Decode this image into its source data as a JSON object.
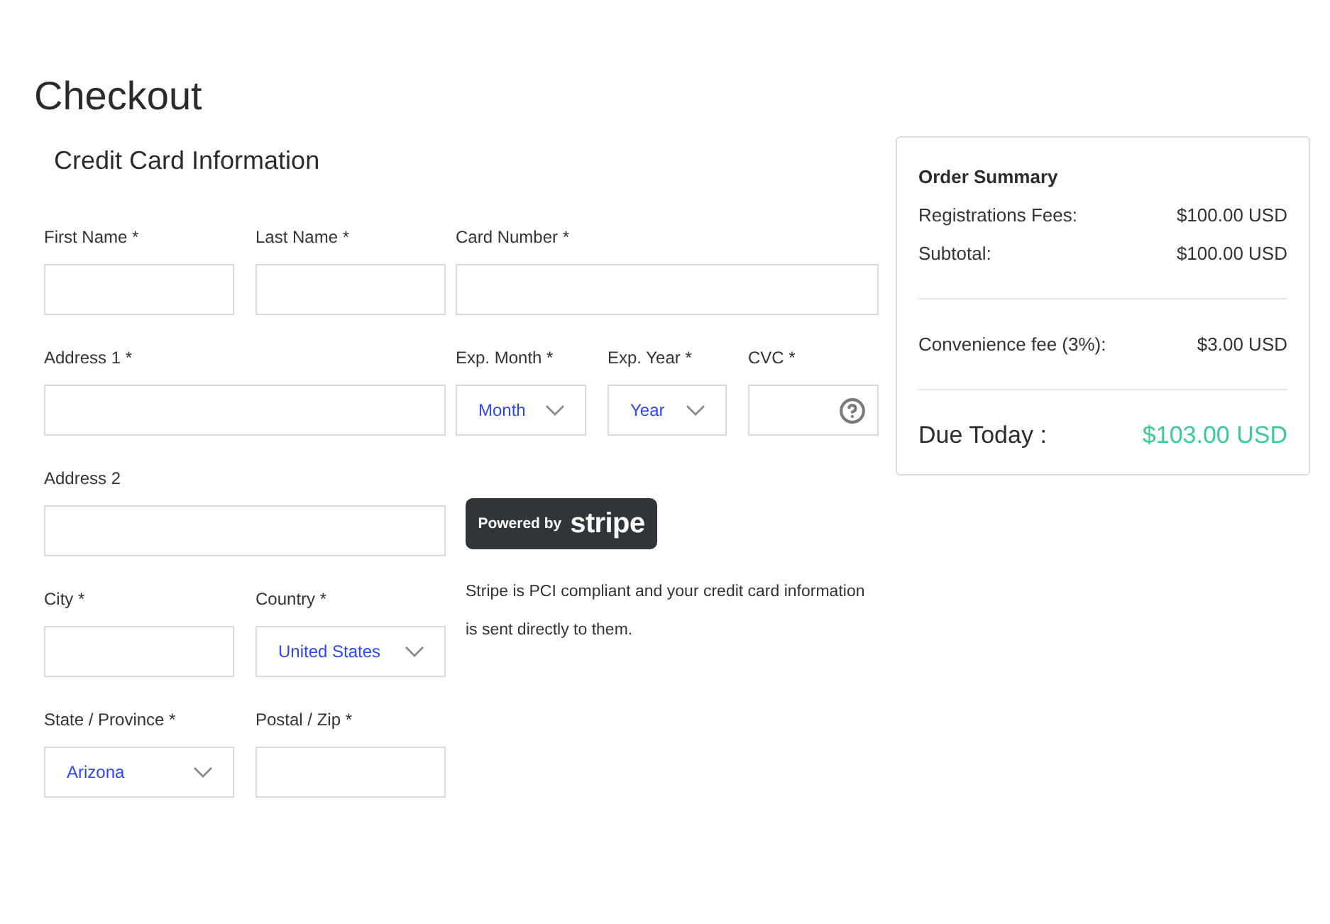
{
  "page": {
    "title": "Checkout"
  },
  "credit_card": {
    "heading": "Credit Card Information",
    "left_rows": [
      [
        {
          "label": "First Name *",
          "kind": "text"
        },
        {
          "label": "Last Name *",
          "kind": "text"
        }
      ],
      [
        {
          "label": "Address 1 *",
          "kind": "text"
        }
      ],
      [
        {
          "label": "Address 2",
          "kind": "text"
        }
      ],
      [
        {
          "label": "City *",
          "kind": "text"
        },
        {
          "label": "Country *",
          "kind": "select",
          "value": "United States"
        }
      ],
      [
        {
          "label": "State / Province *",
          "kind": "select",
          "value": "Arizona"
        },
        {
          "label": "Postal / Zip *",
          "kind": "text"
        }
      ]
    ],
    "right_rows": [
      [
        {
          "label": "Card Number *",
          "kind": "text"
        }
      ],
      [
        {
          "label": "Exp. Month *",
          "kind": "select",
          "value": "Month"
        },
        {
          "label": "Exp. Year *",
          "kind": "select",
          "value": "Year"
        },
        {
          "label": "CVC *",
          "kind": "cvc"
        }
      ]
    ],
    "stripe_badge": {
      "prefix": "Powered by",
      "brand": "stripe"
    },
    "stripe_note": "Stripe is PCI compliant and your credit card information is sent directly to them."
  },
  "order_summary": {
    "title": "Order Summary",
    "groups": [
      [
        {
          "label": "Registrations Fees:",
          "amount": "$100.00 USD"
        },
        {
          "label": "Subtotal:",
          "amount": "$100.00 USD"
        }
      ],
      [
        {
          "label": "Convenience fee (3%):",
          "amount": "$3.00 USD"
        }
      ]
    ],
    "total": {
      "label": "Due Today :",
      "amount": "$103.00 USD"
    }
  }
}
